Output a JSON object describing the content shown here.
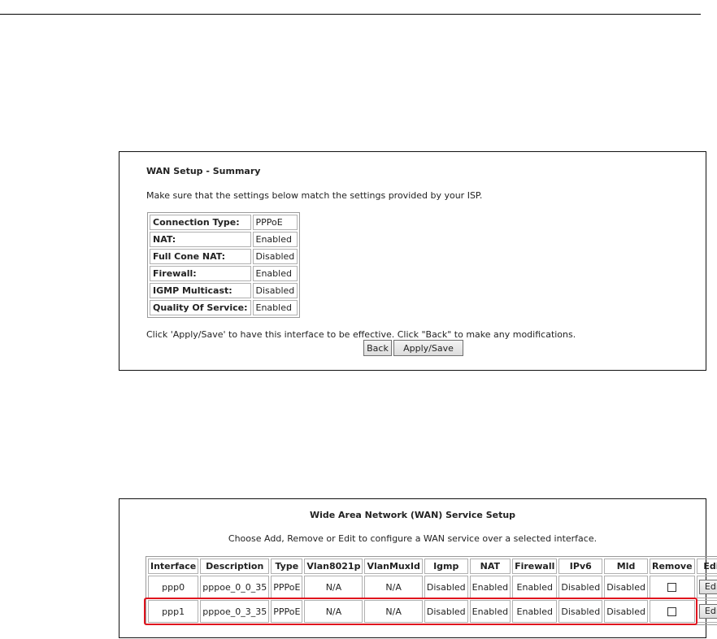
{
  "summary": {
    "title": "WAN Setup - Summary",
    "intro": "Make sure that the settings below match the settings provided by your ISP.",
    "rows": [
      {
        "label": "Connection Type:",
        "value": "PPPoE"
      },
      {
        "label": "NAT:",
        "value": "Enabled"
      },
      {
        "label": "Full Cone NAT:",
        "value": "Disabled"
      },
      {
        "label": "Firewall:",
        "value": "Enabled"
      },
      {
        "label": "IGMP Multicast:",
        "value": "Disabled"
      },
      {
        "label": "Quality Of Service:",
        "value": "Enabled"
      }
    ],
    "hint": "Click 'Apply/Save' to have this interface to be effective. Click \"Back\" to make any modifications.",
    "back_label": "Back",
    "apply_label": "Apply/Save"
  },
  "wan": {
    "title": "Wide Area Network (WAN) Service Setup",
    "intro": "Choose Add, Remove or Edit to configure a WAN service over a selected interface.",
    "columns": [
      "Interface",
      "Description",
      "Type",
      "Vlan8021p",
      "VlanMuxId",
      "Igmp",
      "NAT",
      "Firewall",
      "IPv6",
      "Mld",
      "Remove",
      "Edit"
    ],
    "rows": [
      {
        "interface": "ppp0",
        "description": "pppoe_0_0_35",
        "type": "PPPoE",
        "vlan8021p": "N/A",
        "vlanmuxid": "N/A",
        "igmp": "Disabled",
        "nat": "Enabled",
        "firewall": "Enabled",
        "ipv6": "Disabled",
        "mld": "Disabled",
        "edit_label": "Edit"
      },
      {
        "interface": "ppp1",
        "description": "pppoe_0_3_35",
        "type": "PPPoE",
        "vlan8021p": "N/A",
        "vlanmuxid": "N/A",
        "igmp": "Disabled",
        "nat": "Enabled",
        "firewall": "Enabled",
        "ipv6": "Disabled",
        "mld": "Disabled",
        "edit_label": "Edit"
      }
    ]
  },
  "colors": {
    "highlight": "#e0141e"
  }
}
